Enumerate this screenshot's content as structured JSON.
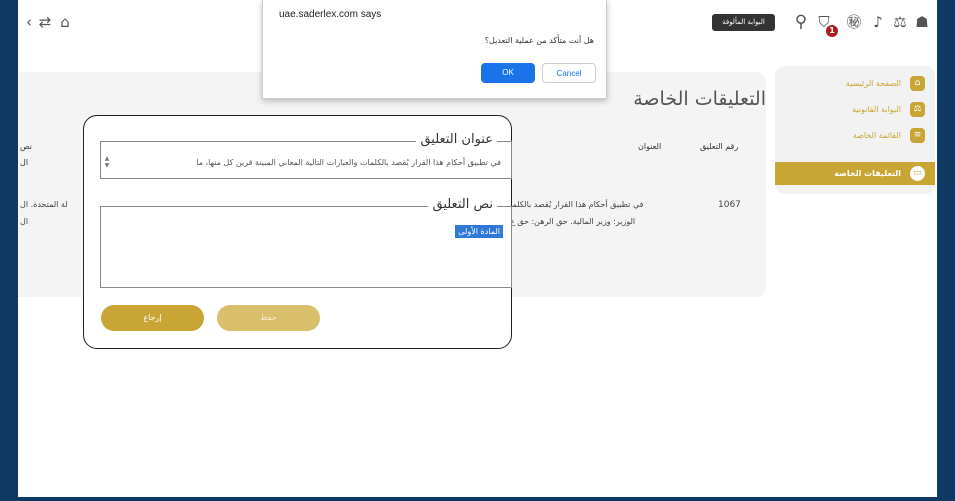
{
  "topbar": {
    "portal_label": "البوابة المألوفة",
    "cart_count": "1",
    "icons": [
      "back-icon",
      "home-icon",
      "search-icon",
      "cart-icon",
      "translate-icon",
      "bell-icon",
      "scales-icon",
      "user-icon"
    ]
  },
  "sidebar": {
    "items": [
      {
        "label": "الصفحة الرئيسية",
        "icon": "home-icon"
      },
      {
        "label": "البوابة القانونية",
        "icon": "scales-icon"
      },
      {
        "label": "القائمة الخاصة",
        "icon": "list-icon"
      },
      {
        "label": "التعليقات الخاصة",
        "icon": "comment-icon",
        "active": true
      }
    ]
  },
  "panel": {
    "title": "التعليقات الخاصة",
    "headers": {
      "comment_number": "رقم التعليق",
      "title": "العنوان",
      "left_col_a": "نص",
      "left_col_b": "ال"
    },
    "row": {
      "number": "1067",
      "text_line1": "في تطبيق أحكام هذا القرار يُقصد بالكلما",
      "text_line2": "الوزير: وزير المالية. حق الرهن: حق ع",
      "left_line1": "لة المتحدة.    ال",
      "left_line2": "ال"
    }
  },
  "modal": {
    "title_legend": "عنوان التعليق",
    "title_value": "في تطبيق أحكام هذا القرار يُقصد بالكلمات والعبارات التالية المعاني المبينة قرين كل منها، ما",
    "body_legend": "نص التعليق",
    "body_selected": "المادة الأولى",
    "back_label": "إرجاع",
    "save_label": "حفظ"
  },
  "confirm": {
    "site": "uae.saderlex.com says",
    "message": "هل أنت متأكد من عملية التعديل؟",
    "ok_label": "OK",
    "cancel_label": "Cancel"
  },
  "colors": {
    "gold": "#c8a534",
    "blue": "#1a73e8",
    "frame": "#0f3a63"
  }
}
